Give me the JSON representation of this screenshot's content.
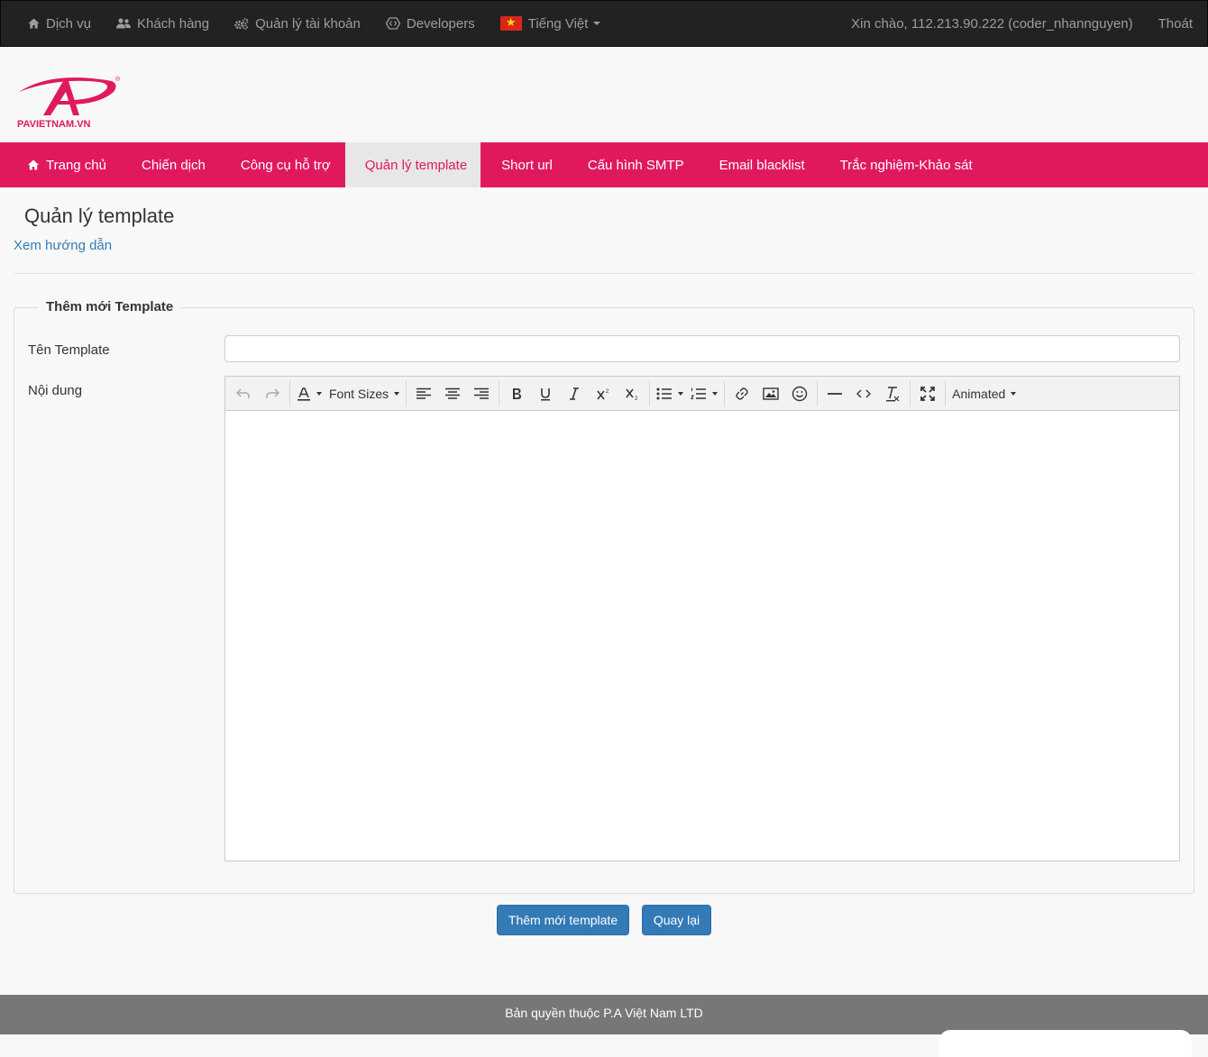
{
  "topbar": {
    "items": [
      {
        "label": "Dịch vụ",
        "icon": "home-icon"
      },
      {
        "label": "Khách hàng",
        "icon": "users-icon"
      },
      {
        "label": "Quản lý tài khoản",
        "icon": "cogs-icon"
      },
      {
        "label": "Developers",
        "icon": "code-icon"
      },
      {
        "label": "Tiếng Việt",
        "icon": "vietnam-flag-icon"
      }
    ],
    "greeting": "Xin chào, 112.213.90.222 (coder_nhannguyen)",
    "logout": "Thoát"
  },
  "logo": {
    "text": "PAVIETNAM.VN",
    "color": "#e0195f"
  },
  "nav": {
    "items": [
      {
        "label": "Trang chủ"
      },
      {
        "label": "Chiến dịch"
      },
      {
        "label": "Công cụ hỗ trợ"
      },
      {
        "label": "Quản lý template"
      },
      {
        "label": "Short url"
      },
      {
        "label": "Cấu hình SMTP"
      },
      {
        "label": "Email blacklist"
      },
      {
        "label": "Trắc nghiệm-Khảo sát"
      }
    ],
    "active": "Quản lý template",
    "color": "#e0195f"
  },
  "page": {
    "title": "Quản lý template",
    "guide_link": "Xem hướng dẫn"
  },
  "form": {
    "legend": "Thêm mới Template",
    "name_label": "Tên Template",
    "name_value": "",
    "content_label": "Nội dung",
    "toolbar": {
      "font_sizes": "Font Sizes",
      "animated": "Animated"
    }
  },
  "buttons": {
    "add": "Thêm mới template",
    "back": "Quay lại",
    "color": "#337ab7"
  },
  "footer": {
    "text": "Bản quyền thuộc P.A Việt Nam LTD"
  }
}
